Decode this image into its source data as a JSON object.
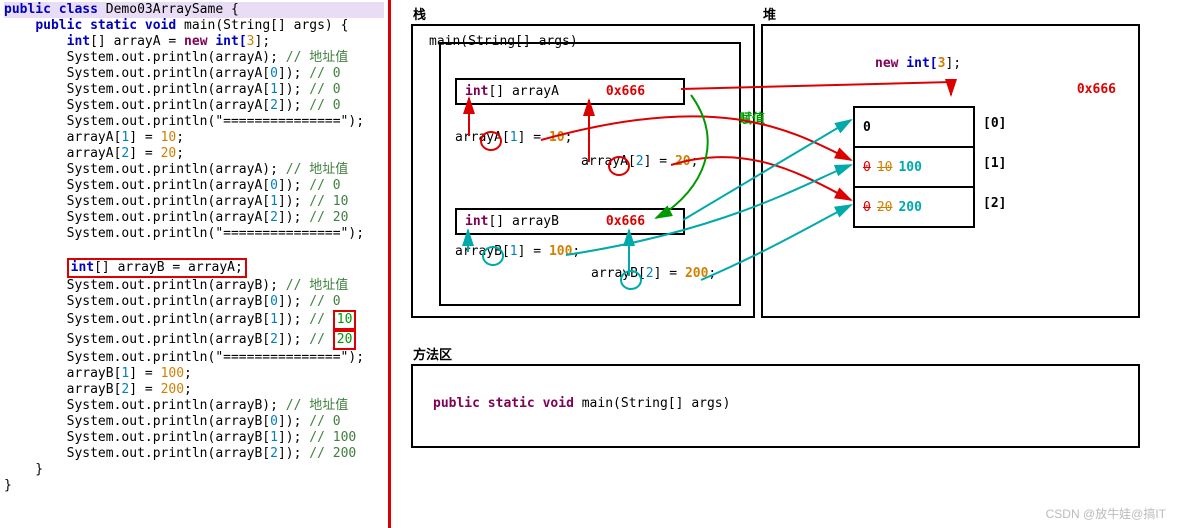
{
  "code": {
    "class_decl": {
      "kw_public": "public",
      "kw_class": "class",
      "name": "Demo03ArraySame",
      "brace": "{"
    },
    "main_decl": {
      "kw_public": "public",
      "kw_static": "static",
      "kw_void": "void",
      "name": "main",
      "params": "(String[] args)",
      "brace": "{"
    },
    "lines": {
      "declA_kw": "int",
      "declA_br": "[] ",
      "declA_nm": "arrayA",
      "declA_eq": " = ",
      "declA_new": "new",
      "declA_type": " int[",
      "declA_size": "3",
      "declA_end": "];",
      "pA": "System.out.println(arrayA);",
      "cA": "// 地址值",
      "pA0": "System.out.println(arrayA[",
      "pA0i": "0",
      "pA0e": "]);",
      "cA0": "// 0",
      "pA1": "System.out.println(arrayA[",
      "pA1i": "1",
      "pA1e": "]);",
      "cA1": "// 0",
      "pA2": "System.out.println(arrayA[",
      "pA2i": "2",
      "pA2e": "]);",
      "cA2": "// 0",
      "sep": "System.out.println(\"===============\");",
      "asgA1": "arrayA[",
      "asgA1i": "1",
      "asgA1e": "] = ",
      "asgA1v": "10",
      "asgA1s": ";",
      "asgA2": "arrayA[",
      "asgA2i": "2",
      "asgA2e": "] = ",
      "asgA2v": "20",
      "asgA2s": ";",
      "pA_": "System.out.println(arrayA);",
      "cA_": "// 地址值",
      "pA0_": "System.out.println(arrayA[",
      "pA0_i": "0",
      "pA0_e": "]);",
      "cA0_": "// 0",
      "pA1_": "System.out.println(arrayA[",
      "pA1_i": "1",
      "pA1_e": "]);",
      "cA1_": "// 10",
      "pA2_": "System.out.println(arrayA[",
      "pA2_i": "2",
      "pA2_e": "]);",
      "cA2_": "// 20",
      "declB_kw": "int",
      "declB_br": "[] ",
      "declB_nm": "arrayB",
      "declB_eq": " = ",
      "declB_rhs": "arrayA;",
      "pB": "System.out.println(arrayB);",
      "cB": "// 地址值",
      "pB0": "System.out.println(arrayB[",
      "pB0i": "0",
      "pB0e": "]);",
      "cB0": "// 0",
      "pB1": "System.out.println(arrayB[",
      "pB1i": "1",
      "pB1e": "]);",
      "cB1v": "10",
      "pB2": "System.out.println(arrayB[",
      "pB2i": "2",
      "pB2e": "]);",
      "cB2v": "20",
      "asgB1": "arrayB[",
      "asgB1i": "1",
      "asgB1e": "] = ",
      "asgB1v": "100",
      "asgB1s": ";",
      "asgB2": "arrayB[",
      "asgB2i": "2",
      "asgB2e": "] = ",
      "asgB2v": "200",
      "asgB2s": ";",
      "pB_": "System.out.println(arrayB);",
      "cB_": "// 地址值",
      "pB0_": "System.out.println(arrayB[",
      "pB0_i": "0",
      "pB0_e": "]);",
      "cB0_": "// 0",
      "pB1_": "System.out.println(arrayB[",
      "pB1_i": "1",
      "pB1_e": "]);",
      "cB1_": "// 100",
      "pB2_": "System.out.println(arrayB[",
      "pB2_i": "2",
      "pB2_e": "]);",
      "cB2_": "// 200",
      "slash_comment": "// "
    }
  },
  "diagram": {
    "stack_title": "栈",
    "heap_title": "堆",
    "method_title": "方法区",
    "main_label": "main(String[] args)",
    "varA_kw": "int",
    "varA_br": "[] ",
    "varA_nm": "arrayA",
    "varA_addr": "0x666",
    "varB_kw": "int",
    "varB_br": "[] ",
    "varB_nm": "arrayB",
    "varB_addr": "0x666",
    "asgnA1": "arrayA[",
    "asgnA1i": "1",
    "asgnA1e": "] = ",
    "asgnA1v": "10",
    "asgnA1s": ";",
    "asgnA2": "arrayA[",
    "asgnA2i": "2",
    "asgnA2e": "] = ",
    "asgnA2v": "20",
    "asgnA2s": ";",
    "asgnB1": "arrayB[",
    "asgnB1i": "1",
    "asgnB1e": "] = ",
    "asgnB1v": "100",
    "asgnB1s": ";",
    "asgnB2": "arrayB[",
    "asgnB2i": "2",
    "asgnB2e": "] = ",
    "asgnB2v": "200",
    "asgnB2s": ";",
    "assign_label": "赋值",
    "new_kw": "new",
    "new_type": " int[",
    "new_size": "3",
    "new_end": "];",
    "heap_addr": "0x666",
    "cells": [
      {
        "old": "0",
        "old2": "",
        "new": "",
        "idx": "[0]"
      },
      {
        "old": "0",
        "old2": "10",
        "new": "100",
        "idx": "[1]"
      },
      {
        "old": "0",
        "old2": "20",
        "new": "200",
        "idx": "[2]"
      }
    ],
    "method_sig": {
      "kw_public": "public",
      "kw_static": "static",
      "kw_void": "void",
      "name": "main",
      "params": "(String[] args)"
    }
  },
  "watermark": "CSDN @放牛娃@搞IT"
}
